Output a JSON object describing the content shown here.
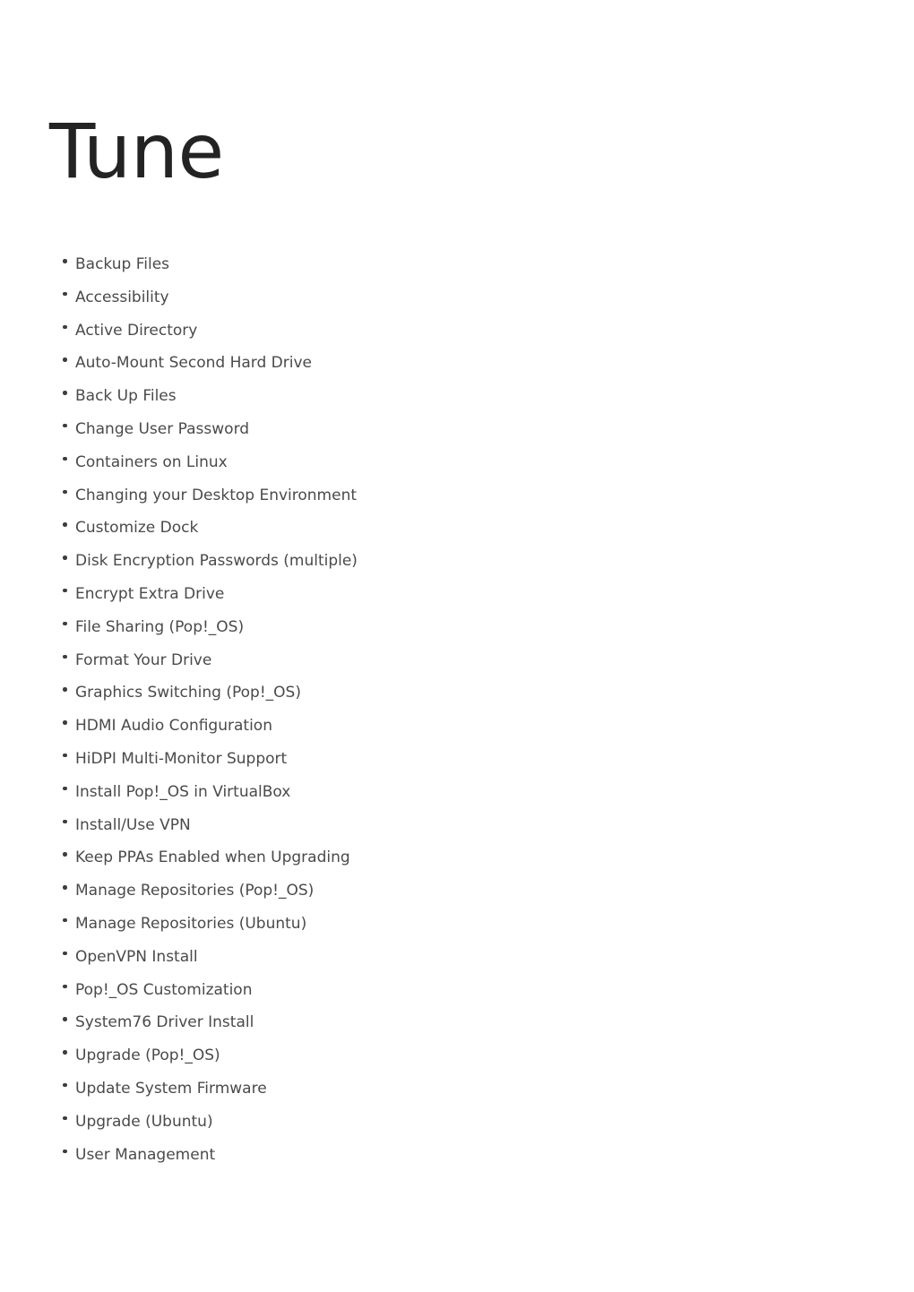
{
  "document": {
    "title": "Tune",
    "background_color": "#ffffff",
    "title_color": "#232323",
    "text_color": "#4a4a4a",
    "bullet_color": "#3d3d3d",
    "topics": [
      {
        "label": "Backup Files"
      },
      {
        "label": "Accessibility"
      },
      {
        "label": "Active Directory"
      },
      {
        "label": "Auto-Mount Second Hard Drive"
      },
      {
        "label": "Back Up Files"
      },
      {
        "label": "Change User Password"
      },
      {
        "label": "Containers on Linux"
      },
      {
        "label": "Changing your Desktop Environment"
      },
      {
        "label": "Customize Dock"
      },
      {
        "label": "Disk Encryption Passwords (multiple)"
      },
      {
        "label": "Encrypt Extra Drive"
      },
      {
        "label": "File Sharing (Pop!_OS)"
      },
      {
        "label": "Format Your Drive"
      },
      {
        "label": "Graphics Switching (Pop!_OS)"
      },
      {
        "label": "HDMI Audio Configuration"
      },
      {
        "label": "HiDPI Multi-Monitor Support"
      },
      {
        "label": "Install Pop!_OS in VirtualBox"
      },
      {
        "label": "Install/Use VPN"
      },
      {
        "label": "Keep PPAs Enabled when Upgrading"
      },
      {
        "label": "Manage Repositories (Pop!_OS)"
      },
      {
        "label": "Manage Repositories (Ubuntu)"
      },
      {
        "label": "OpenVPN Install"
      },
      {
        "label": "Pop!_OS Customization"
      },
      {
        "label": "System76 Driver Install"
      },
      {
        "label": "Upgrade (Pop!_OS)"
      },
      {
        "label": "Update System Firmware"
      },
      {
        "label": "Upgrade (Ubuntu)"
      },
      {
        "label": "User Management"
      }
    ]
  }
}
